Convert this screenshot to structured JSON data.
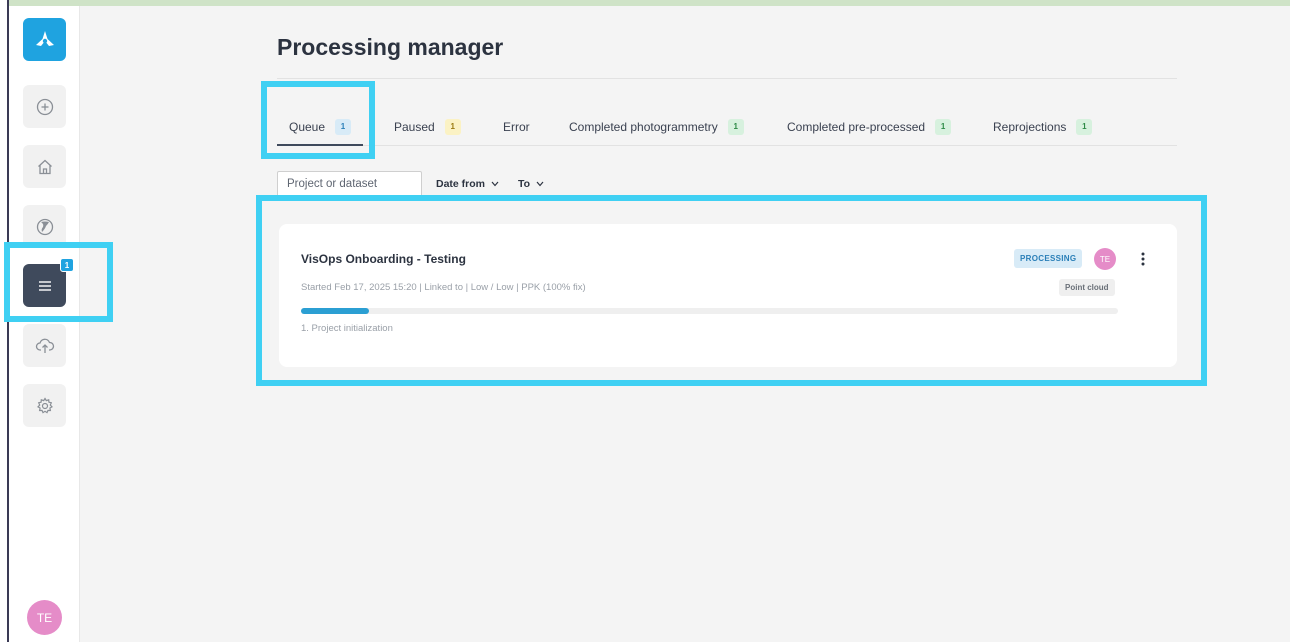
{
  "colors": {
    "brand": "#1fa3e0",
    "highlight": "#3fd0f3",
    "sidebar_active": "#3f4a5c",
    "avatar": "#e58cc8",
    "progress": "#2b9fd3"
  },
  "sidebar": {
    "logo_icon": "logo-icon",
    "items": [
      {
        "icon": "plus-circle-icon",
        "active": false
      },
      {
        "icon": "home-icon",
        "active": false
      },
      {
        "icon": "globe-icon",
        "active": false
      },
      {
        "icon": "menu-icon",
        "active": true,
        "badge": "1"
      },
      {
        "icon": "upload-cloud-icon",
        "active": false
      },
      {
        "icon": "gear-icon",
        "active": false
      }
    ],
    "user_initials": "TE"
  },
  "page": {
    "title": "Processing manager"
  },
  "tabs": [
    {
      "label": "Queue",
      "count": "1",
      "active": true
    },
    {
      "label": "Paused",
      "count": "1"
    },
    {
      "label": "Error"
    },
    {
      "label": "Completed photogrammetry",
      "count": "1"
    },
    {
      "label": "Completed pre-processed",
      "count": "1"
    },
    {
      "label": "Reprojections",
      "count": "1"
    }
  ],
  "filters": {
    "search_placeholder": "Project or dataset",
    "date_from_label": "Date from",
    "to_label": "To"
  },
  "jobs": [
    {
      "title": "VisOps Onboarding - Testing",
      "meta": "Started Feb 17, 2025 15:20 | Linked to | Low / Low | PPK (100% fix)",
      "status": "PROCESSING",
      "user_initials": "TE",
      "type": "Point cloud",
      "progress_fraction": 0.083,
      "step": "1. Project initialization"
    }
  ]
}
